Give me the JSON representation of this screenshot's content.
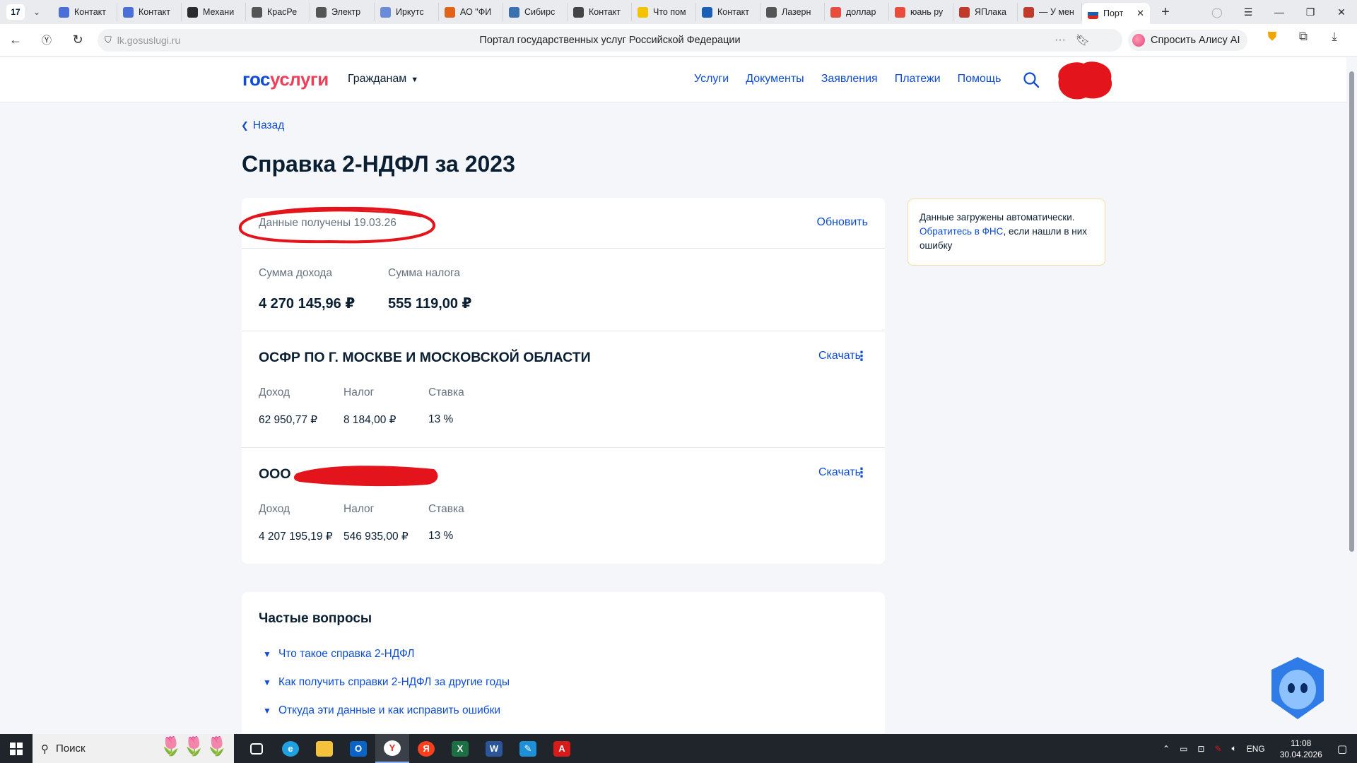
{
  "browser": {
    "tab_count": "17",
    "tabs": [
      {
        "label": "Контакт",
        "color": "#4a6fd8"
      },
      {
        "label": "Контакт",
        "color": "#4a6fd8"
      },
      {
        "label": "Механи",
        "color": "#2b2b2b"
      },
      {
        "label": "КрасРе",
        "color": "#555555"
      },
      {
        "label": "Электр",
        "color": "#555555"
      },
      {
        "label": "Иркутс",
        "color": "#6a8bd8"
      },
      {
        "label": "АО \"ФИ",
        "color": "#e0631c"
      },
      {
        "label": "Сибирс",
        "color": "#3a6fb0"
      },
      {
        "label": "Контакт",
        "color": "#444444"
      },
      {
        "label": "Что пом",
        "color": "#f3c300"
      },
      {
        "label": "Контакт",
        "color": "#1a5fb4"
      },
      {
        "label": "Лазерн",
        "color": "#555555"
      },
      {
        "label": "доллар",
        "color": "#e74c3c"
      },
      {
        "label": "юань ру",
        "color": "#e74c3c"
      },
      {
        "label": "ЯПлака",
        "color": "#c0392b"
      },
      {
        "label": "— У мен",
        "color": "#c0392b"
      }
    ],
    "active_tab": {
      "label": "Порт",
      "color": "#1a5fb4"
    },
    "url": "lk.gosuslugi.ru",
    "page_title": "Портал государственных услуг Российской Федерации",
    "alice_label": "Спросить Алису AI"
  },
  "header": {
    "logo_part1": "гос",
    "logo_part2": "услуги",
    "audience": "Гражданам",
    "nav": [
      "Услуги",
      "Документы",
      "Заявления",
      "Платежи",
      "Помощь"
    ]
  },
  "page": {
    "back": "Назад",
    "title": "Справка 2-НДФЛ за 2023",
    "received": "Данные получены 19.03.26",
    "refresh": "Обновить",
    "totals": {
      "income_label": "Сумма дохода",
      "income_value": "4 270 145,96 ₽",
      "tax_label": "Сумма налога",
      "tax_value": "555 119,00 ₽"
    },
    "orgs": [
      {
        "name": "ОСФР ПО Г. МОСКВЕ И МОСКОВСКОЙ ОБЛАСТИ",
        "download": "Скачать",
        "income_label": "Доход",
        "income": "62 950,77 ₽",
        "tax_label": "Налог",
        "tax": "8 184,00 ₽",
        "rate_label": "Ставка",
        "rate": "13 %"
      },
      {
        "name": "ООО",
        "download": "Скачать",
        "income_label": "Доход",
        "income": "4 207 195,19 ₽",
        "tax_label": "Налог",
        "tax": "546 935,00 ₽",
        "rate_label": "Ставка",
        "rate": "13 %"
      }
    ],
    "side_note": {
      "text1": "Данные загружены автоматически.",
      "link": "Обратитесь в ФНС",
      "text2": ", если нашли в них ошибку"
    },
    "faq": {
      "title": "Частые вопросы",
      "items": [
        "Что такое справка 2-НДФЛ",
        "Как получить справки 2-НДФЛ за другие годы",
        "Откуда эти данные и как исправить ошибки"
      ]
    }
  },
  "colors": {
    "brand_blue": "#0d4cd3",
    "brand_red": "#ee3f58",
    "annotation_red": "#e3141b"
  },
  "taskbar": {
    "search": "Поиск",
    "lang": "ENG",
    "time": "11:08",
    "date": "30.04.2026"
  }
}
